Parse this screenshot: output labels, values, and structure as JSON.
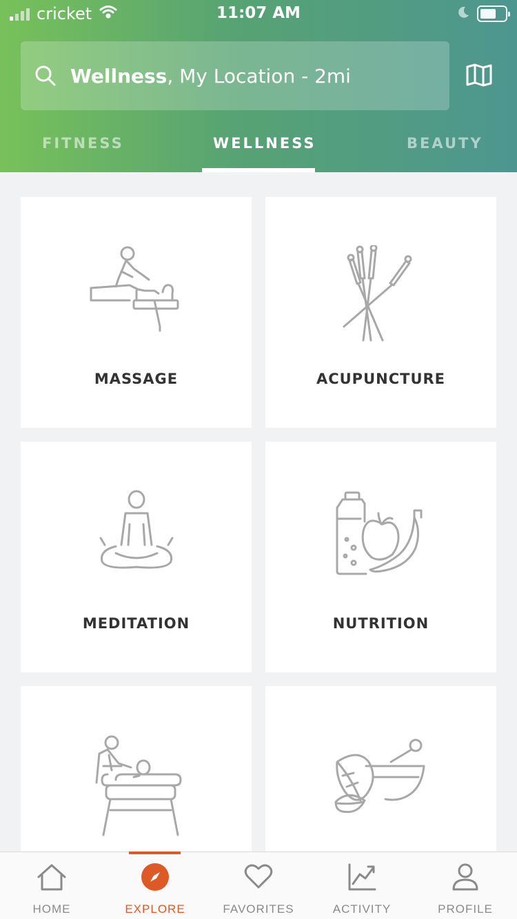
{
  "status_bar": {
    "carrier": "cricket",
    "time": "11:07 AM"
  },
  "search": {
    "category": "Wellness",
    "location_text": ", My Location - 2mi"
  },
  "tabs": [
    {
      "label": "FITNESS",
      "active": false
    },
    {
      "label": "WELLNESS",
      "active": true
    },
    {
      "label": "BEAUTY",
      "active": false
    }
  ],
  "categories": [
    {
      "label": "MASSAGE",
      "icon": "massage-icon"
    },
    {
      "label": "ACUPUNCTURE",
      "icon": "acupuncture-icon"
    },
    {
      "label": "MEDITATION",
      "icon": "meditation-icon"
    },
    {
      "label": "NUTRITION",
      "icon": "nutrition-icon"
    },
    {
      "label": "",
      "icon": "physical-therapy-icon"
    },
    {
      "label": "",
      "icon": "herbal-mortar-icon"
    }
  ],
  "bottom_nav": [
    {
      "label": "HOME",
      "icon": "home-icon",
      "active": false
    },
    {
      "label": "EXPLORE",
      "icon": "compass-icon",
      "active": true
    },
    {
      "label": "FAVORITES",
      "icon": "heart-icon",
      "active": false
    },
    {
      "label": "ACTIVITY",
      "icon": "chart-icon",
      "active": false
    },
    {
      "label": "PROFILE",
      "icon": "person-icon",
      "active": false
    }
  ],
  "colors": {
    "accent": "#dd5a27",
    "header_gradient_start": "#78c15a",
    "header_gradient_end": "#4d9690",
    "icon_gray": "#a8a8a8"
  }
}
